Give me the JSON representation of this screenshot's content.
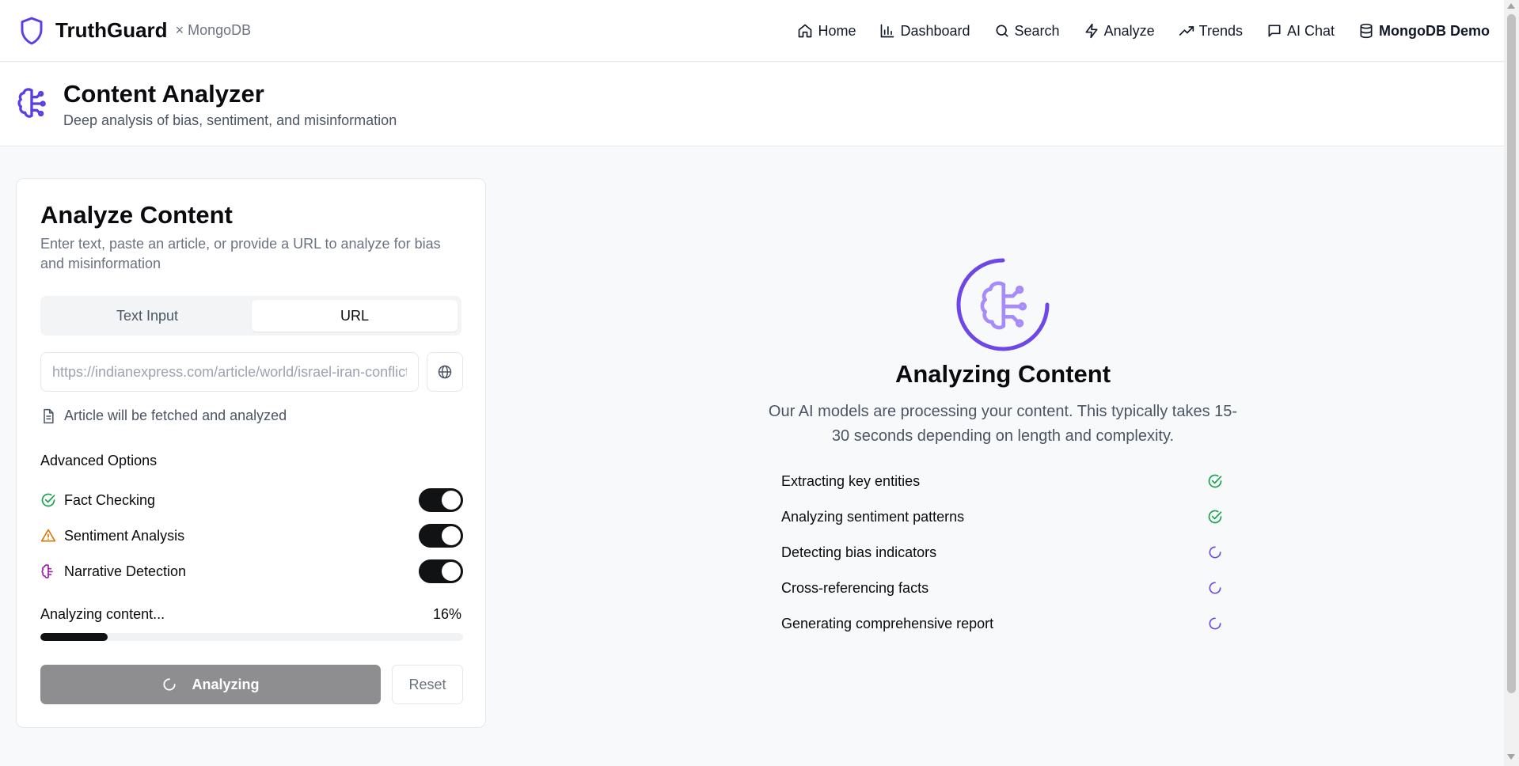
{
  "brand": {
    "name": "TruthGuard",
    "sub": "× MongoDB",
    "color": "#5b3fe6"
  },
  "nav": {
    "home": "Home",
    "dashboard": "Dashboard",
    "search": "Search",
    "analyze": "Analyze",
    "trends": "Trends",
    "ai_chat": "AI Chat",
    "mongodb_demo": "MongoDB Demo"
  },
  "page": {
    "title": "Content Analyzer",
    "subtitle": "Deep analysis of bias, sentiment, and misinformation",
    "icon": "brain-circuit-icon"
  },
  "analyze_card": {
    "title": "Analyze Content",
    "description": "Enter text, paste an article, or provide a URL to analyze for bias and misinformation",
    "tabs": [
      {
        "label": "Text Input",
        "active": false
      },
      {
        "label": "URL",
        "active": true
      }
    ],
    "url_placeholder": "https://indianexpress.com/article/world/israel-iran-conflict",
    "fetch_note": "Article will be fetched and analyzed",
    "advanced_title": "Advanced Options",
    "options": [
      {
        "label": "Fact Checking",
        "enabled": true,
        "icon": "check-circle-icon",
        "color": "#16a34a"
      },
      {
        "label": "Sentiment Analysis",
        "enabled": true,
        "icon": "alert-triangle-icon",
        "color": "#d97706"
      },
      {
        "label": "Narrative Detection",
        "enabled": true,
        "icon": "brain-icon",
        "color": "#a21caf"
      }
    ],
    "progress_label": "Analyzing content...",
    "progress_text": "16%",
    "progress_value": 0.16,
    "analyze_button": "Analyzing",
    "reset_button": "Reset"
  },
  "analyzing_panel": {
    "title": "Analyzing Content",
    "description": "Our AI models are processing your content. This typically takes 15-30 seconds depending on length and complexity.",
    "accent": "#6d47e8",
    "steps": [
      {
        "label": "Extracting key entities",
        "status": "done"
      },
      {
        "label": "Analyzing sentiment patterns",
        "status": "done"
      },
      {
        "label": "Detecting bias indicators",
        "status": "pending"
      },
      {
        "label": "Cross-referencing facts",
        "status": "pending"
      },
      {
        "label": "Generating comprehensive report",
        "status": "pending"
      }
    ]
  }
}
